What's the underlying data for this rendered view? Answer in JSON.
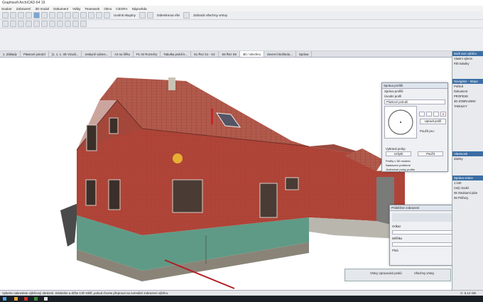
{
  "window": {
    "title": "Graphisoft ArchiCAD-64 19"
  },
  "menu": [
    "Soubor",
    "Zobrazení",
    "3D modul",
    "Dokument",
    "Volby",
    "Teamwork",
    "Okno",
    "CEGRA",
    "Nápověda"
  ],
  "toolbar": {
    "show_groups": "Uvolnit skupiny",
    "show_all": "Zobrazit všechny vrstvy",
    "hide_plane": "Odemknout vše"
  },
  "tabs": [
    "1. Základy",
    "Plastové potrubí",
    "[1. 1. 1. 3D Vizuál...",
    "Jeskyně výkres...",
    "A3 na šířku",
    "PL 02 Rozměry",
    "Tabulka prvků k...",
    "S1 Řez S1 - S1'",
    "S6 Řez S6",
    "3D / všechno",
    "Severní ktohledu...",
    "Správa"
  ],
  "active_tab": "3D / všechno",
  "profile_dialog": {
    "title": "Správa profilů",
    "section": "Správa profilů",
    "label_edit": "Úvodní profil",
    "selected_profile": "Plastové potrubí",
    "edit_button": "Upravit profil",
    "use_for": "Použít pro:",
    "label_selection": "Vybrané prvky:",
    "btn_left": "Uchytit",
    "btn_right": "Použít",
    "tree1": "Profily v 3D modelu",
    "tree2": "Nastavení potřebné",
    "tree3": "Jedinečné prvky profilu"
  },
  "preview_dialog": {
    "title": "Průběžné zobrazení",
    "label_a": "Odkaz",
    "label_b": "Měřítko",
    "label_c": "Plná"
  },
  "bottombar": {
    "a": "Vrstvy zpracování prvků",
    "b": "Všechny vrstvy"
  },
  "rightpanel": {
    "header": "Možnosti výběru",
    "items": [
      "Vlastní výkres",
      "Filtr tabulky",
      "Navigátor - Mapa",
      "Pohled",
      "Dokument",
      "PROFESE",
      "3D ZOBRAZENÍ",
      "TABULKY",
      "Vlastnosti",
      "Zámky",
      "Správa vrstev",
      "1:100",
      "Celý model",
      "06 Strukturní plán",
      "06 Průřezy"
    ]
  },
  "status": "Vyberte nakreslete výběrový obrázek. Stiskněte a držte Ctrl+Shift, pokud chcete přepnout na normální zobrazení výběru.",
  "status_right": "C: 6.14 GB"
}
